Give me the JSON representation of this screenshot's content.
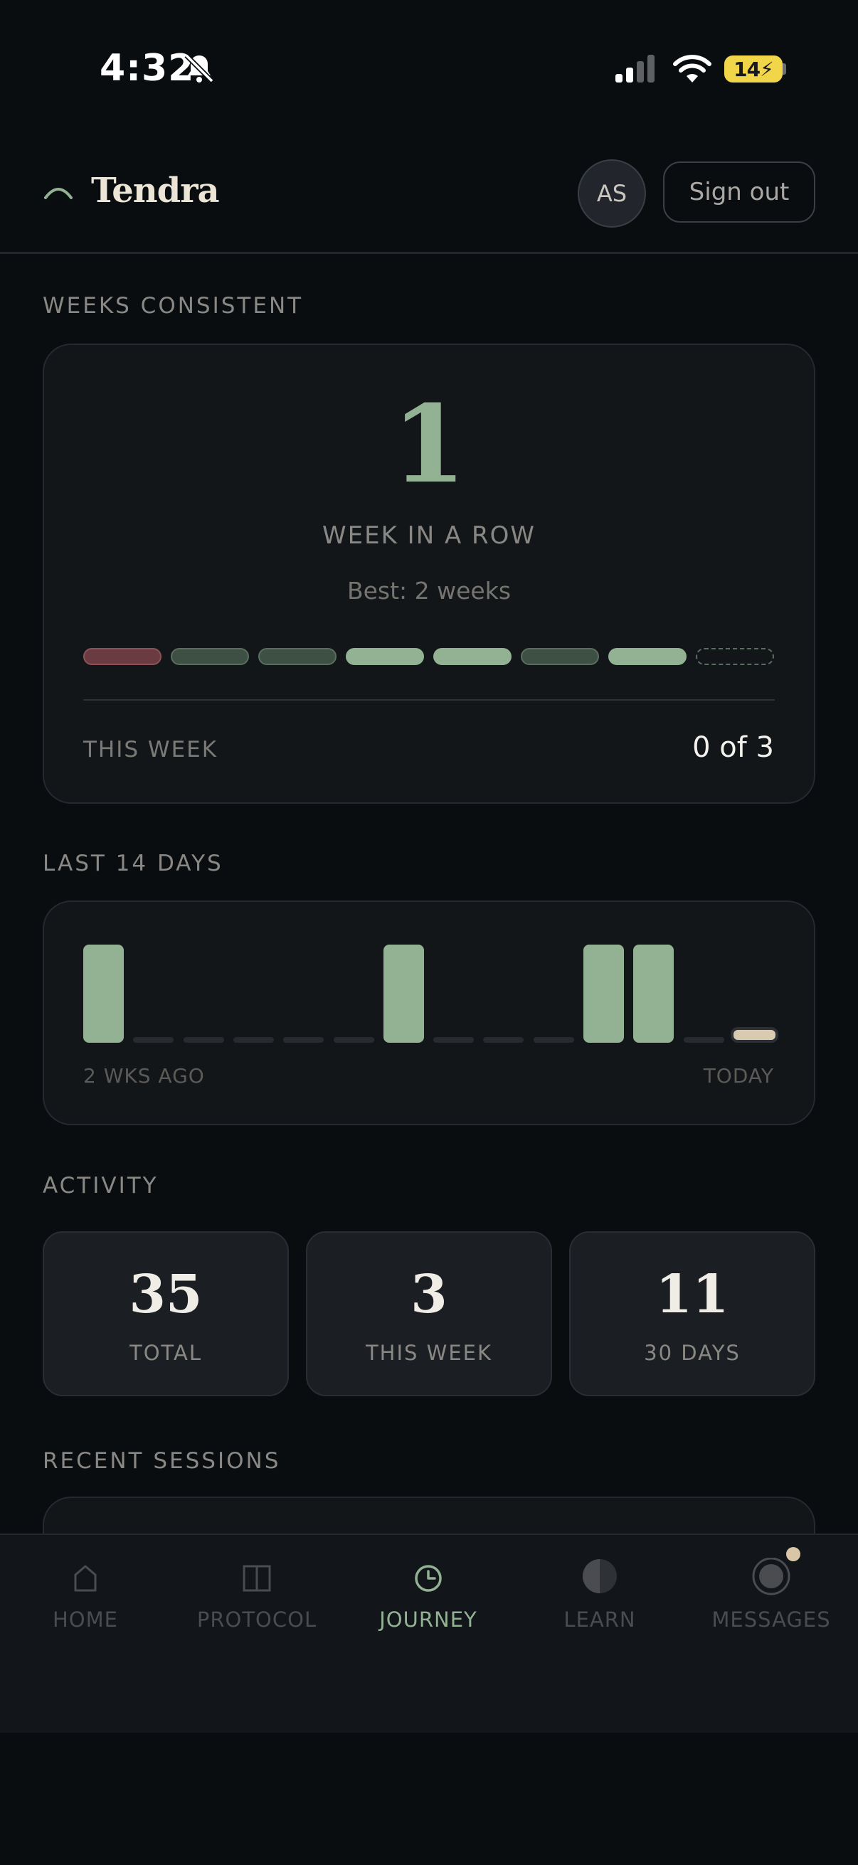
{
  "status_bar": {
    "time": "4:32",
    "battery": "14"
  },
  "header": {
    "brand": "Tendra",
    "avatar_initials": "AS",
    "sign_out_label": "Sign out"
  },
  "streak": {
    "section_title": "WEEKS CONSISTENT",
    "count": "1",
    "label": "WEEK IN A ROW",
    "best": "Best: 2 weeks",
    "weeks": [
      "missed",
      "partial",
      "partial",
      "full",
      "full",
      "partial",
      "full",
      "current"
    ],
    "this_week_label": "THIS WEEK",
    "this_week_value": "0 of 3"
  },
  "last14": {
    "section_title": "LAST 14 DAYS",
    "days": [
      1,
      0,
      0,
      0,
      0,
      0,
      1,
      0,
      0,
      0,
      1,
      1,
      0,
      "today"
    ],
    "start_label": "2 WKS AGO",
    "end_label": "TODAY"
  },
  "activity": {
    "section_title": "ACTIVITY",
    "stats": [
      {
        "value": "35",
        "label": "TOTAL"
      },
      {
        "value": "3",
        "label": "THIS WEEK"
      },
      {
        "value": "11",
        "label": "30 DAYS"
      }
    ]
  },
  "recent": {
    "section_title": "RECENT SESSIONS"
  },
  "nav": {
    "items": [
      {
        "label": "HOME",
        "icon": "home-icon"
      },
      {
        "label": "PROTOCOL",
        "icon": "protocol-icon"
      },
      {
        "label": "JOURNEY",
        "icon": "journey-icon"
      },
      {
        "label": "LEARN",
        "icon": "learn-icon"
      },
      {
        "label": "MESSAGES",
        "icon": "messages-icon"
      }
    ],
    "active": "JOURNEY"
  },
  "colors": {
    "accent": "#92b293",
    "background": "#0a0d10",
    "card": "#131619",
    "missed": "#6a3c41",
    "today": "#d8cbb0"
  }
}
